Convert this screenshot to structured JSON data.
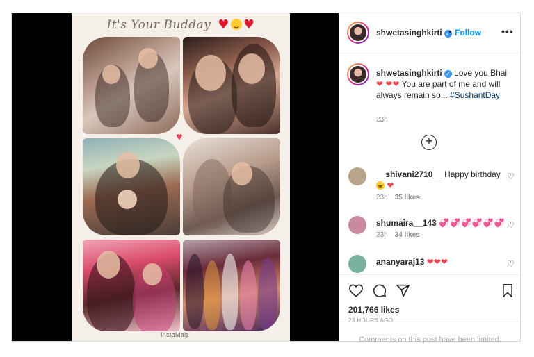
{
  "media": {
    "collage_title": "It's Your Budday",
    "title_emojis": [
      "heart",
      "smiling-face",
      "heart"
    ],
    "watermark": "InstaMag"
  },
  "header": {
    "username": "shwetasinghkirti",
    "separator": "•",
    "follow_label": "Follow",
    "more_label": "•••"
  },
  "caption": {
    "username": "shwetasinghkirti",
    "text_start": "Love you Bhai",
    "text_mid": "You are part of me and will always remain so...",
    "hashtag": "#SushantDay",
    "time": "23h"
  },
  "load_more_label": "+",
  "comments": [
    {
      "username": "__shivani2710__",
      "text": "Happy birthday",
      "time": "23h",
      "likes": "35 likes",
      "avatar_color": "#b8a48a"
    },
    {
      "username": "shumaira__143",
      "text": "💞💞💞💞💞💞",
      "time": "23h",
      "likes": "34 likes",
      "avatar_color": "#c98aa0"
    },
    {
      "username": "ananyaraj13",
      "text": "❤❤❤",
      "time": "",
      "likes": "",
      "avatar_color": "#7ab0a0"
    }
  ],
  "actions": {
    "likes": "201,766 likes",
    "post_time": "23 HOURS AGO"
  },
  "footer": {
    "limited_text": "Comments on this post have been limited."
  },
  "colors": {
    "accent_blue": "#0095f6",
    "like_red": "#ed4956",
    "verified_blue": "#3897f0"
  }
}
